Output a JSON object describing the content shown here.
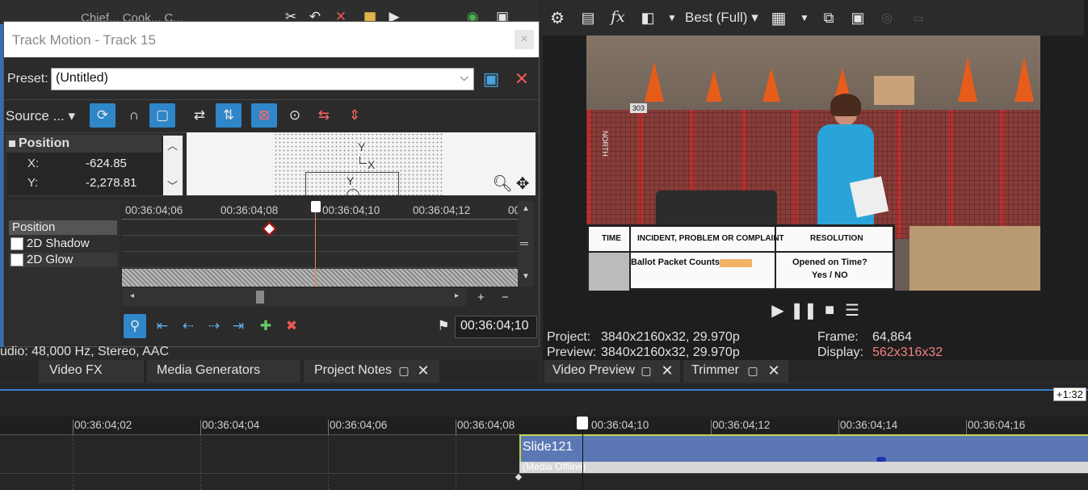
{
  "back_toolbar": {
    "title_fragment": "Chief... Cook... C..."
  },
  "track_motion": {
    "title": "Track Motion - Track 15",
    "close_glyph": "×",
    "preset_label": "Preset:",
    "preset_value": "(Untitled)",
    "source_label": "Source ...",
    "position_header": "Position",
    "x_label": "X:",
    "x_value": "-624.85",
    "y_label": "Y:",
    "y_value": "-2,278.81",
    "canvas_y_outer": "Y",
    "canvas_x_outer": "X",
    "canvas_y_inner": "Y",
    "props": [
      "Position",
      "2D Shadow",
      "2D Glow"
    ],
    "ruler_ticks": [
      "00:36:04;06",
      "00:36:04;08",
      "00:36:04;10",
      "00:36:04;12",
      "00:"
    ],
    "scroll_plus": "+",
    "scroll_minus": "−",
    "current_time": "00:36:04;10"
  },
  "project_info": {
    "audio_line": "udio: 48,000 Hz, Stereo, AAC"
  },
  "left_tabs": [
    "Video FX",
    "Media Generators",
    "Project Notes"
  ],
  "preview": {
    "quality": "Best (Full)",
    "fx_glyph": "fx",
    "project_label": "Project:",
    "project_value": "3840x2160x32, 29.970p",
    "preview_label": "Preview:",
    "preview_value": "3840x2160x32, 29.970p",
    "frame_label": "Frame:",
    "frame_value": "64,864",
    "display_label": "Display:",
    "display_value": "562x316x32",
    "display_color": "#f08080",
    "video": {
      "table_headers": [
        "TIME",
        "INCIDENT, PROBLEM OR COMPLAINT",
        "RESOLUTION"
      ],
      "row_text_1": "Ballot Packet Counts:",
      "row_text_2": "Opened on Time?",
      "row_text_3": "Yes / NO",
      "rack_label": "303",
      "side_label": "NORTH"
    }
  },
  "right_tabs": [
    "Video Preview",
    "Trimmer"
  ],
  "timeline": {
    "offset_badge": "+1:32",
    "ticks": [
      "00:36:04;02",
      "00:36:04;04",
      "00:36:04;06",
      "00:36:04;08",
      "00:36:04;10",
      "00:36:04;12",
      "00:36:04;14",
      "00:36:04;16"
    ],
    "clip_name": "Slide121",
    "clip_sub": "(Media Offline)"
  },
  "colors": {
    "accent": "#2f86c9",
    "clip": "#5b78b5",
    "panel": "#1e1e1e",
    "playhead": "#e8835a"
  }
}
